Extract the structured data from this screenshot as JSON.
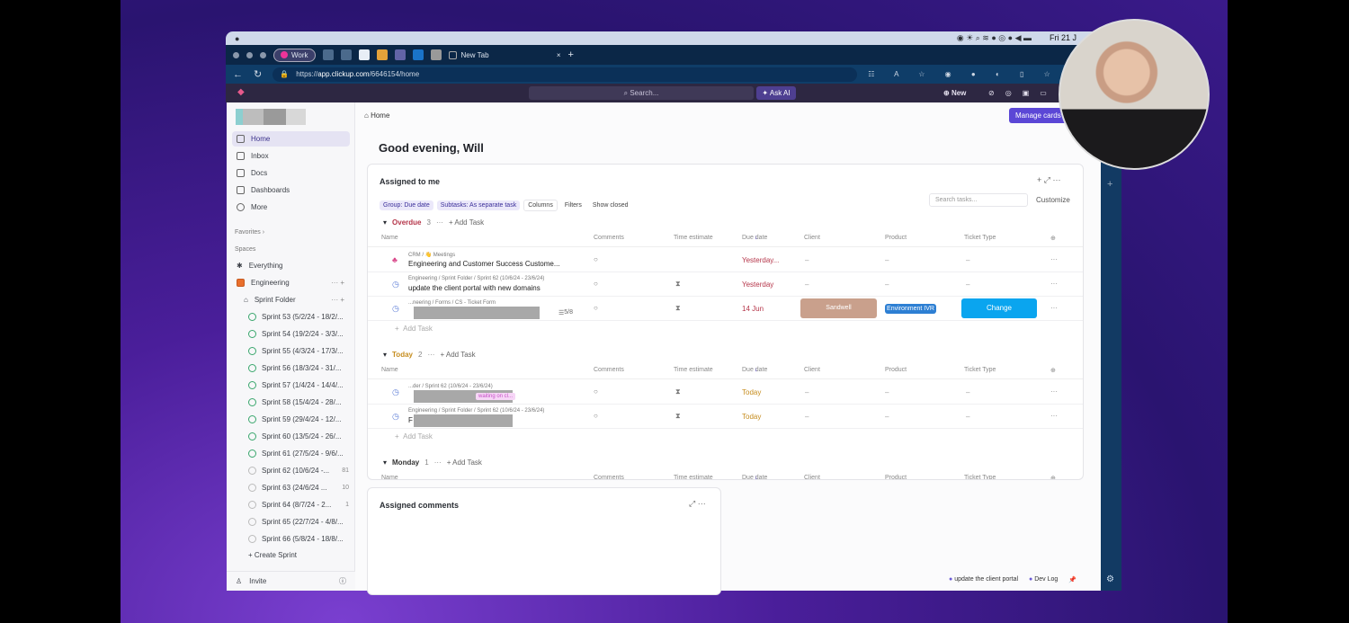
{
  "menubar": {
    "clock": "Fri 21 J"
  },
  "browser": {
    "profile": "Work",
    "tab_title": "New Tab",
    "url_prefix": "https://",
    "url_host": "app.clickup.com",
    "url_path": "/6646154/home"
  },
  "topbar": {
    "search_placeholder": "Search...",
    "ask_ai": "Ask AI",
    "new": "New"
  },
  "sidebar": {
    "nav": [
      {
        "label": "Home",
        "icon": "home-icon"
      },
      {
        "label": "Inbox",
        "icon": "inbox-icon"
      },
      {
        "label": "Docs",
        "icon": "docs-icon"
      },
      {
        "label": "Dashboards",
        "icon": "dashboard-icon"
      },
      {
        "label": "More",
        "icon": "more-icon"
      }
    ],
    "favorites": "Favorites ›",
    "spaces": "Spaces",
    "everything": "Everything",
    "space": "Engineering",
    "folder": "Sprint Folder",
    "sprints": [
      {
        "label": "Sprint 53 (5/2/24 - 18/2/...",
        "count": ""
      },
      {
        "label": "Sprint 54 (19/2/24 - 3/3/...",
        "count": ""
      },
      {
        "label": "Sprint 55 (4/3/24 - 17/3/...",
        "count": ""
      },
      {
        "label": "Sprint 56 (18/3/24 - 31/...",
        "count": ""
      },
      {
        "label": "Sprint 57 (1/4/24 - 14/4/...",
        "count": ""
      },
      {
        "label": "Sprint 58 (15/4/24 - 28/...",
        "count": ""
      },
      {
        "label": "Sprint 59 (29/4/24 - 12/...",
        "count": ""
      },
      {
        "label": "Sprint 60 (13/5/24 - 26/...",
        "count": ""
      },
      {
        "label": "Sprint 61 (27/5/24 - 9/6/...",
        "count": ""
      },
      {
        "label": "Sprint 62 (10/6/24 -...",
        "count": "81"
      },
      {
        "label": "Sprint 63 (24/6/24 ...",
        "count": "10"
      },
      {
        "label": "Sprint 64 (8/7/24 - 2...",
        "count": "1"
      },
      {
        "label": "Sprint 65 (22/7/24 - 4/8/...",
        "count": ""
      },
      {
        "label": "Sprint 66 (5/8/24 - 18/8/...",
        "count": ""
      }
    ],
    "create_sprint": "+ Create Sprint",
    "invite": "Invite"
  },
  "main": {
    "breadcrumb": "Home",
    "manage_cards": "Manage cards",
    "greeting": "Good evening, Will",
    "assigned": {
      "title": "Assigned to me",
      "chips": [
        "Group: Due date",
        "Subtasks: As separate task",
        "Columns",
        "Filters",
        "Show closed"
      ],
      "search_placeholder": "Search tasks...",
      "customize": "Customize",
      "columns": [
        "Name",
        "Comments",
        "Time estimate",
        "Due date",
        "Client",
        "Product",
        "Ticket Type"
      ],
      "add_task": "+ Add Task",
      "add_task_row": "Add Task",
      "groups": [
        {
          "name": "Overdue",
          "count": "3",
          "color": "#b5364a",
          "rows": [
            {
              "path": "CRM  /  👋 Meetings",
              "name": "Engineering and Customer Success Custome...",
              "due": "Yesterday...",
              "client": "–",
              "product": "–",
              "ticket": "–"
            },
            {
              "path": "Engineering  /  Sprint Folder  /  Sprint 62 (10/6/24 - 23/6/24)",
              "name": "update the client portal with new domains",
              "due": "Yesterday",
              "client": "–",
              "product": "–",
              "ticket": "–"
            },
            {
              "path": "...neering  /  Forms  /  CS - Ticket Form",
              "name": "",
              "subtasks": "5/8",
              "due": "14 Jun",
              "client": "Sandwell",
              "product": "Environment IVR",
              "ticket": "Change"
            }
          ]
        },
        {
          "name": "Today",
          "count": "2",
          "color": "#c68d1f",
          "rows": [
            {
              "path": "...der  /  Sprint 62 (10/6/24 - 23/6/24)",
              "name": "",
              "tag": "waiting on cl...",
              "due": "Today",
              "client": "–",
              "product": "–",
              "ticket": "–"
            },
            {
              "path": "Engineering  /  Sprint Folder  /  Sprint 62 (10/6/24 - 23/6/24)",
              "name": "F",
              "due": "Today",
              "client": "–",
              "product": "–",
              "ticket": "–"
            }
          ]
        },
        {
          "name": "Monday",
          "count": "1",
          "rows": []
        }
      ],
      "colors": {
        "client_sandwell": "#c9a08c",
        "product_env": "#2d7fd3",
        "ticket_change": "#0aa5ef"
      }
    },
    "comments": {
      "title": "Assigned comments"
    }
  },
  "bottom": {
    "items": [
      "update the client portal",
      "Dev Log"
    ]
  }
}
